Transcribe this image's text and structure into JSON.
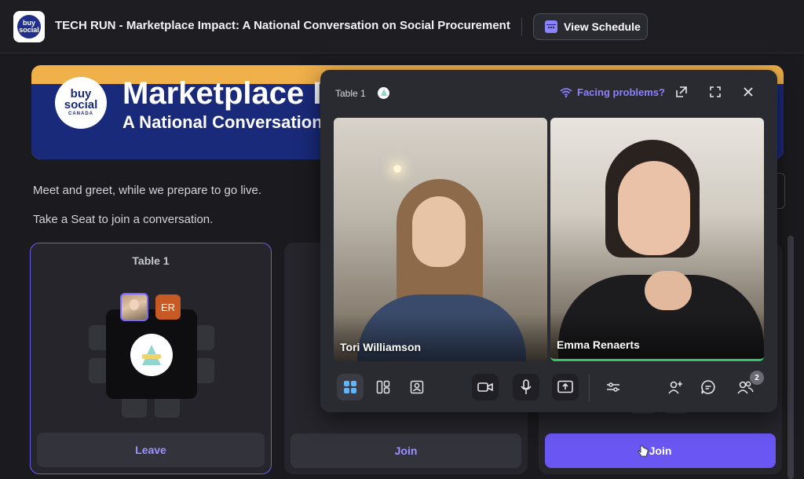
{
  "header": {
    "logo_text": "buy social",
    "event_title": "TECH RUN - Marketplace Impact: A National Conversation on Social Procurement",
    "schedule_label": "View Schedule"
  },
  "banner": {
    "logo_line1": "buy",
    "logo_line2": "social",
    "logo_line3": "CANADA",
    "title": "Marketplace Impact",
    "subtitle": "A National Conversation on Social Procurement"
  },
  "intro": {
    "line1": "Meet and greet, while we prepare to go live.",
    "line2": "Take a Seat to join a conversation."
  },
  "tables": [
    {
      "title": "Table 1",
      "button_label": "Leave",
      "initials": "ER"
    },
    {
      "title": "",
      "button_label": "Join"
    },
    {
      "title": "",
      "button_label": "Join"
    }
  ],
  "call": {
    "table_label": "Table 1",
    "facing_problems": "Facing problems?",
    "participants": [
      {
        "name": "Tori Williamson"
      },
      {
        "name": "Emma Renaerts"
      }
    ],
    "participant_count": "2"
  },
  "icons": {
    "schedule": "calendar-icon",
    "facing": "wifi-warning-icon",
    "popout": "popout-icon",
    "fullscreen": "fullscreen-icon",
    "close": "close-icon",
    "grid": "grid-layout-icon",
    "sidebar": "sidebar-layout-icon",
    "speaker": "speaker-layout-icon",
    "camera": "camera-icon",
    "mic": "microphone-icon",
    "share": "screen-share-icon",
    "settings": "settings-sliders-icon",
    "add_person": "add-person-icon",
    "chat": "chat-icon",
    "people": "people-icon"
  },
  "colors": {
    "accent": "#6a56f2",
    "banner_blue": "#1a2a7a",
    "banner_gold": "#f0b04a",
    "speaking": "#36c46a"
  }
}
